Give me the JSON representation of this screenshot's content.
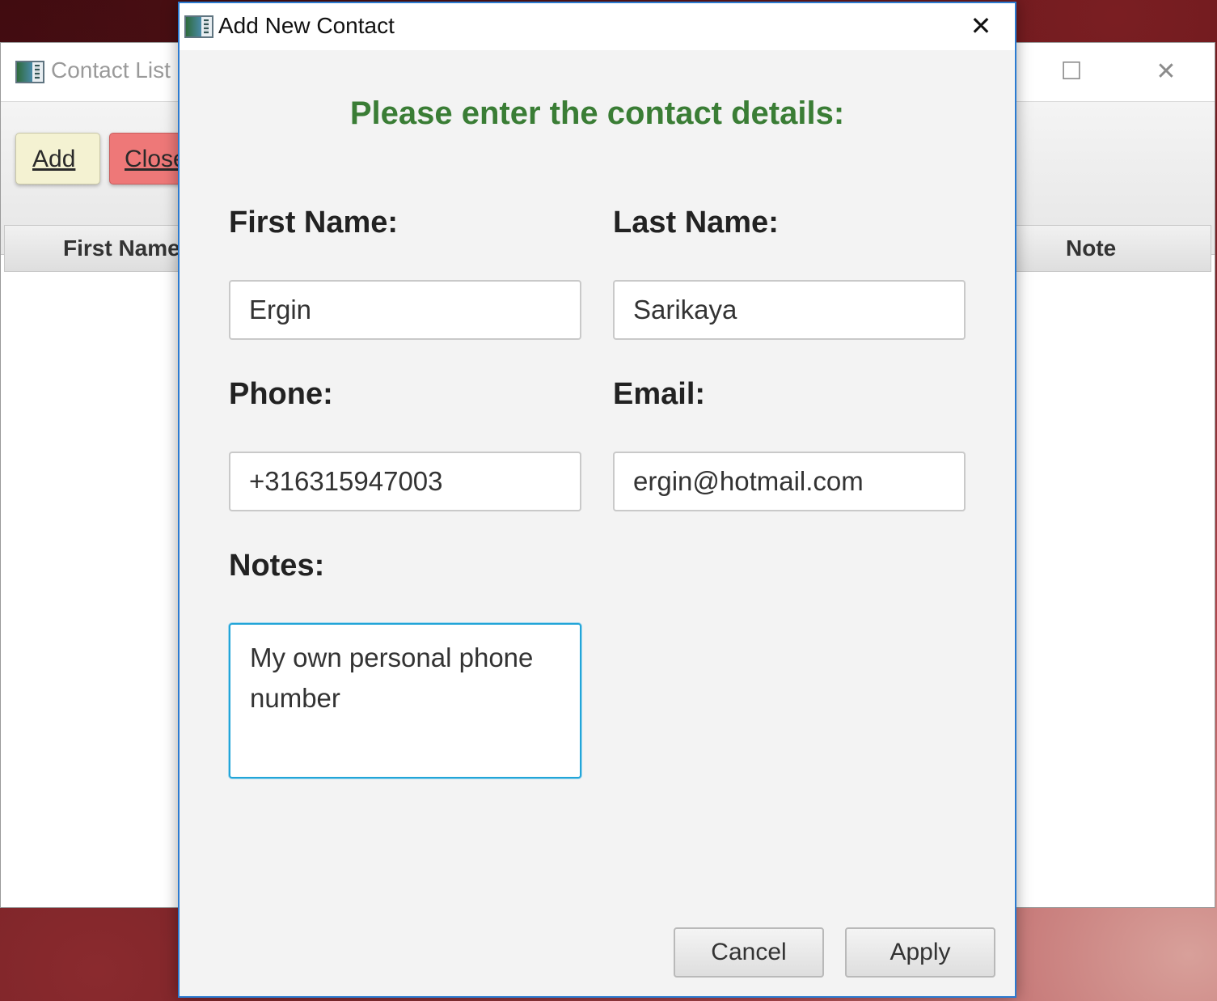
{
  "background_window": {
    "title": "Contact List",
    "maximize_icon": "☐",
    "close_icon": "✕",
    "toolbar": {
      "add_label": "Add",
      "close_label": "Close"
    },
    "table": {
      "columns": [
        "First Name",
        "Note"
      ]
    }
  },
  "dialog": {
    "title": "Add New Contact",
    "close_icon": "✕",
    "heading": "Please enter the contact details:",
    "fields": {
      "first_name": {
        "label": "First Name:",
        "value": "Ergin"
      },
      "last_name": {
        "label": "Last Name:",
        "value": "Sarikaya"
      },
      "phone": {
        "label": "Phone:",
        "value": "+316315947003"
      },
      "email": {
        "label": "Email:",
        "value": "ergin@hotmail.com"
      },
      "notes": {
        "label": "Notes:",
        "value": "My own personal phone number"
      }
    },
    "buttons": {
      "cancel": "Cancel",
      "apply": "Apply"
    }
  },
  "colors": {
    "heading": "#3a7d35",
    "add_button": "#f4f2d2",
    "close_button": "#ee7878",
    "focus_border": "#22a5d8",
    "dialog_border": "#2b7bd1"
  }
}
